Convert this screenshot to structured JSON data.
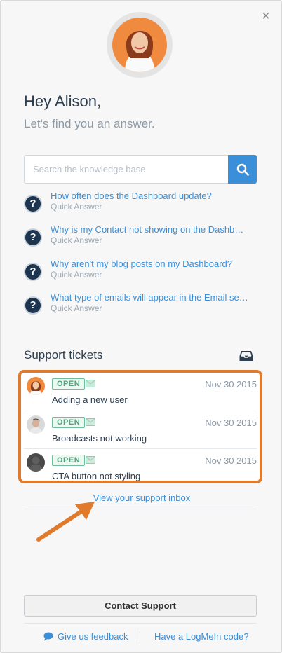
{
  "header": {
    "close_label": "×",
    "greeting": "Hey Alison,",
    "subgreeting": "Let's find you an answer."
  },
  "search": {
    "placeholder": "Search the knowledge base",
    "value": ""
  },
  "faqs": [
    {
      "icon": "question-icon",
      "glyph": "?",
      "title": "How often does the Dashboard update?",
      "subtitle": "Quick Answer"
    },
    {
      "icon": "question-icon",
      "glyph": "?",
      "title": "Why is my Contact not showing on the Dashb…",
      "subtitle": "Quick Answer"
    },
    {
      "icon": "question-icon",
      "glyph": "?",
      "title": "Why aren't my blog posts on my Dashboard?",
      "subtitle": "Quick Answer"
    },
    {
      "icon": "question-icon",
      "glyph": "?",
      "title": "What type of emails will appear in the Email se…",
      "subtitle": "Quick Answer"
    }
  ],
  "tickets": {
    "heading": "Support tickets",
    "items": [
      {
        "status": "OPEN",
        "date": "Nov 30 2015",
        "subject": "Adding a new user"
      },
      {
        "status": "OPEN",
        "date": "Nov 30 2015",
        "subject": "Broadcasts not working"
      },
      {
        "status": "OPEN",
        "date": "Nov 30 2015",
        "subject": "CTA button not styling"
      }
    ],
    "view_inbox": "View your support inbox"
  },
  "footer": {
    "contact_support": "Contact Support",
    "feedback": "Give us feedback",
    "logmein": "Have a LogMeIn code?"
  },
  "colors": {
    "accent": "#3b8fd9",
    "highlight": "#e07a2c",
    "status_open": "#4ba17a"
  }
}
